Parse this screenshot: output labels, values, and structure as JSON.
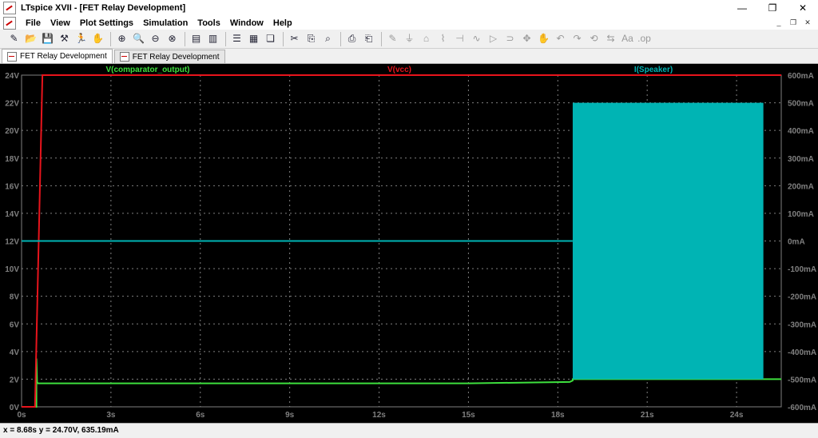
{
  "window": {
    "title": "LTspice XVII - [FET Relay Development]",
    "minimize": "—",
    "restore": "❐",
    "close": "✕"
  },
  "menu": {
    "items": [
      "File",
      "View",
      "Plot Settings",
      "Simulation",
      "Tools",
      "Window",
      "Help"
    ],
    "mdi_minimize": "_",
    "mdi_restore": "❐",
    "mdi_close": "✕"
  },
  "toolbar": {
    "icons": [
      "new-schematic",
      "open",
      "save",
      "control-panel",
      "run",
      "halt",
      "zoom-in",
      "zoom-pan",
      "zoom-out",
      "zoom-fit",
      "autorange",
      "manual-limits",
      "tile-horizontal",
      "tile-vertical",
      "cascade",
      "cut",
      "copy",
      "find",
      "print",
      "print-preview",
      "wire",
      "ground",
      "label",
      "resistor",
      "capacitor",
      "inductor",
      "diode",
      "component",
      "move",
      "drag",
      "undo",
      "redo",
      "rotate",
      "mirror",
      "text",
      "spice-directive"
    ]
  },
  "tabs": [
    {
      "label": "FET Relay Development",
      "active": true
    },
    {
      "label": "FET Relay Development",
      "active": false
    }
  ],
  "status": {
    "text": "x = 8.68s   y = 24.70V, 635.19mA"
  },
  "colors": {
    "background": "#000000",
    "vcc": "#e8141c",
    "comparator": "#3ee03e",
    "speaker": "#00b4b4",
    "grid": "#808080"
  },
  "chart_data": {
    "type": "line",
    "xlabel": "",
    "ylabel": "",
    "xlim": [
      0,
      25.5
    ],
    "ylim_left": [
      0,
      24
    ],
    "ylim_right": [
      -600,
      600
    ],
    "x_ticks": [
      "0s",
      "3s",
      "6s",
      "9s",
      "12s",
      "15s",
      "18s",
      "21s",
      "24s"
    ],
    "y_ticks_left": [
      "0V",
      "2V",
      "4V",
      "6V",
      "8V",
      "10V",
      "12V",
      "14V",
      "16V",
      "18V",
      "20V",
      "22V",
      "24V"
    ],
    "y_ticks_right": [
      "-600mA",
      "-500mA",
      "-400mA",
      "-300mA",
      "-200mA",
      "-100mA",
      "0mA",
      "100mA",
      "200mA",
      "300mA",
      "400mA",
      "500mA",
      "600mA"
    ],
    "series": [
      {
        "name": "V(comparator_output)",
        "axis": "left",
        "x": [
          0,
          0.5,
          0.5,
          0.52,
          0.55,
          15,
          18.4,
          18.5,
          18.5,
          25.5
        ],
        "y": [
          0,
          0,
          3.5,
          1.8,
          1.7,
          1.7,
          1.8,
          1.9,
          2.0,
          2.0
        ]
      },
      {
        "name": "V(vcc)",
        "axis": "left",
        "x": [
          0,
          0.45,
          0.7,
          25.5
        ],
        "y": [
          0,
          0,
          24,
          24
        ]
      },
      {
        "name": "I(Speaker)",
        "axis": "right",
        "x": [
          0,
          18.5
        ],
        "y": [
          0,
          0
        ],
        "band": {
          "x_start": 18.5,
          "x_end": 24.9,
          "y_min": -500,
          "y_max": 500
        }
      }
    ]
  }
}
